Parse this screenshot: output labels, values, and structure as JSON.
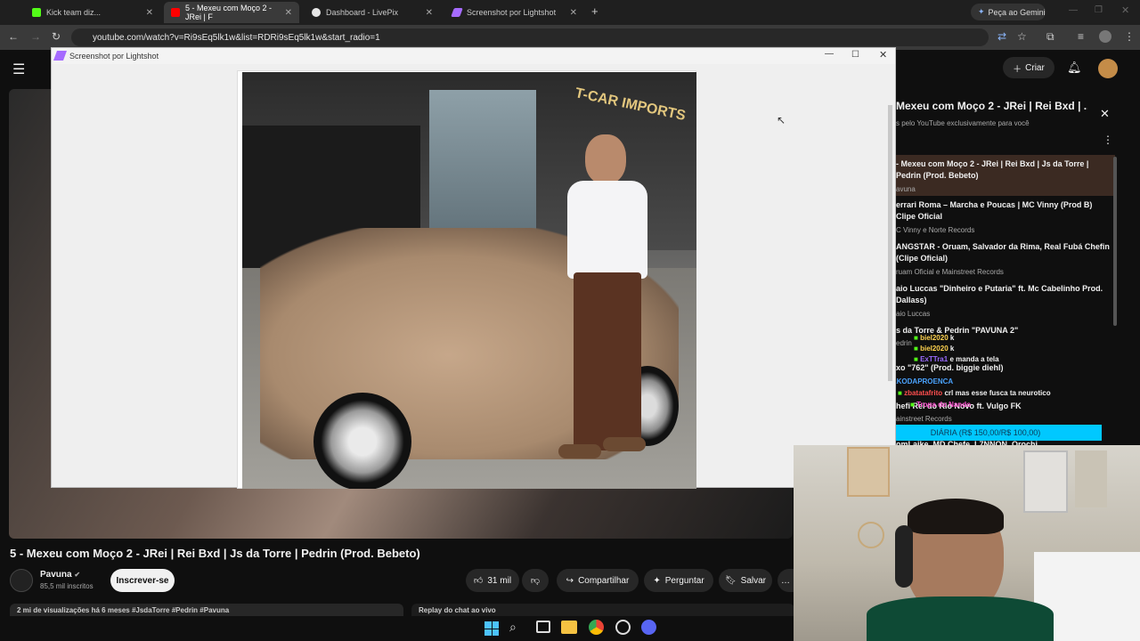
{
  "tabs": [
    {
      "label": "Kick team diz...",
      "icon": "kick-icon",
      "active": false
    },
    {
      "label": "5 - Mexeu com Moço 2 - JRei | F",
      "icon": "youtube-icon",
      "active": true
    },
    {
      "label": "Dashboard - LivePix",
      "icon": "livepix-icon",
      "active": false
    },
    {
      "label": "Screenshot por Lightshot",
      "icon": "lightshot-icon",
      "active": false
    }
  ],
  "gemini_button": "Peça ao Gemini",
  "url": "youtube.com/watch?v=Ri9sEq5lk1w&list=RDRi9sEq5lk1w&start_radio=1",
  "lightshot": {
    "title": "Screenshot por Lightshot",
    "photo_sign": "T-CAR IMPORTS"
  },
  "youtube": {
    "create_label": "Criar",
    "video_title": "5 - Mexeu com Moço 2 - JRei | Rei Bxd | Js da Torre | Pedrin (Prod. Bebeto)",
    "channel": "Pavuna",
    "subscribers": "85,5 mil inscritos",
    "subscribe_label": "Inscrever-se",
    "likes": "31 mil",
    "share_label": "Compartilhar",
    "ask_label": "Perguntar",
    "save_label": "Salvar",
    "views": "2 mi de visualizações há 6 meses  #JsdaTorre #Pedrin #Pavuna",
    "chat_replay": "Replay do chat ao vivo"
  },
  "playlist": {
    "title": "Mexeu com Moço 2 - JRei | Rei Bxd | ...",
    "subtitle": "s pelo YouTube exclusivamente para você",
    "items": [
      {
        "title": "- Mexeu com Moço 2 - JRei | Rei Bxd | Js da Torre | Pedrin (Prod. Bebeto)",
        "sub": "avuna"
      },
      {
        "title": "errari Roma – Marcha e Poucas | MC Vinny (Prod B) Clipe Oficial",
        "sub": "C Vinny e Norte Records"
      },
      {
        "title": "ANGSTAR - Oruam, Salvador da Rima, Real Fubá Chefin (Clipe Oficial)",
        "sub": "ruam Oficial e Mainstreet Records"
      },
      {
        "title": "aio Luccas \"Dinheiro e Putaria\" ft. Mc Cabelinho Prod. Dallass)",
        "sub": "aio Luccas"
      },
      {
        "title": "s da Torre & Pedrin \"PAVUNA 2\"",
        "sub": "edrin"
      }
    ],
    "extra1": "xo \"762\" (Prod. biggie diehl)",
    "extra2": "hefi    Rei do Rio Novo ft. Vulgo FK",
    "extra2_sub": "ainstreet Records",
    "extra3": "omLaike, MD Chefe, L7NNON, Orochi,"
  },
  "chat": [
    {
      "user": "biel2020",
      "msg": "k",
      "color": "#ffd34f"
    },
    {
      "user": "biel2020",
      "msg": "k",
      "color": "#ffd34f"
    },
    {
      "user": "ExTTra1",
      "msg": "e manda a tela",
      "color": "#9b6bff"
    },
    {
      "user": "KAKODAPROENCA",
      "msg": "",
      "color": "#4aa3ff"
    },
    {
      "user": "zbatatafrito",
      "msg": "crl mas esse fusca ta neurotico",
      "color": "#ff4f4f"
    },
    {
      "user": "Tropa do Nando",
      "msg": "",
      "color": "#ff4fd1"
    }
  ],
  "donation_bar": "DIÁRIA (R$ 150,00/R$ 100,00)",
  "colors": {
    "youtube_red": "#ff0000",
    "donation_cyan": "#00c8ff",
    "kick_green": "#53fc18"
  }
}
